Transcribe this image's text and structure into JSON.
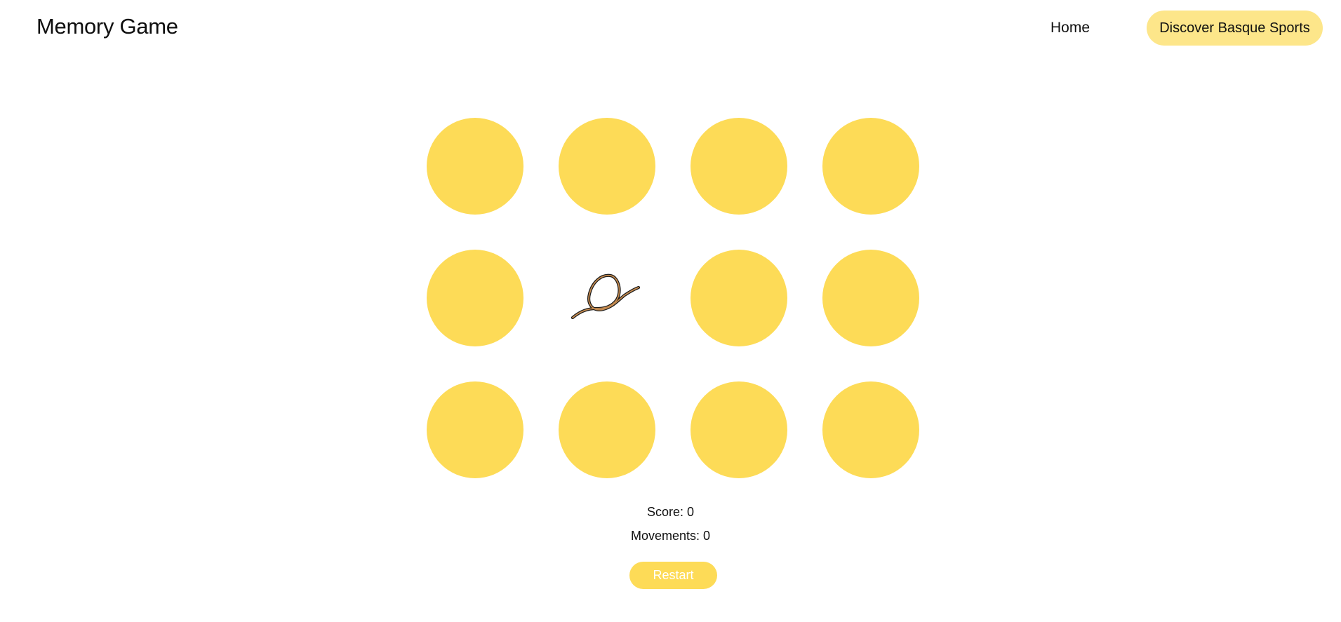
{
  "header": {
    "title": "Memory Game",
    "nav": {
      "home_label": "Home",
      "discover_label": "Discover Basque Sports"
    }
  },
  "board": {
    "cards": [
      {
        "state": "face-down"
      },
      {
        "state": "face-down"
      },
      {
        "state": "face-down"
      },
      {
        "state": "face-down"
      },
      {
        "state": "face-down"
      },
      {
        "state": "face-up",
        "icon": "rope-icon"
      },
      {
        "state": "face-down"
      },
      {
        "state": "face-down"
      },
      {
        "state": "face-down"
      },
      {
        "state": "face-down"
      },
      {
        "state": "face-down"
      },
      {
        "state": "face-down"
      }
    ]
  },
  "stats": {
    "score_label": "Score: 0",
    "movements_label": "Movements: 0"
  },
  "controls": {
    "restart_label": "Restart"
  },
  "colors": {
    "card_back": "#fddb57",
    "nav_button": "#fde68a",
    "restart_text": "#ffffff"
  }
}
